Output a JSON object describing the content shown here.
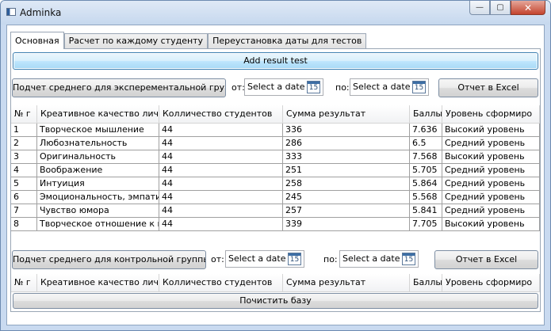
{
  "window": {
    "title": "Adminka",
    "min_glyph": "—",
    "max_glyph": "▢",
    "close_glyph": "✕"
  },
  "tabs": [
    {
      "label": "Основная"
    },
    {
      "label": "Расчет по каждому студенту"
    },
    {
      "label": "Переустановка даты для тестов"
    }
  ],
  "main": {
    "add_button": "Add result test",
    "experimental": {
      "calc_button": "Подчет среднего для эксперементальной группы",
      "from_label": "от:",
      "from_date": "Select a date",
      "to_label": "по:",
      "to_date": "Select a date",
      "export_button": "Отчет в Excel"
    },
    "control": {
      "calc_button": "Подчет среднего для контрольной группы",
      "from_label": "от:",
      "from_date": "Select a date",
      "to_label": "по:",
      "to_date": "Select a date",
      "export_button": "Отчет в Excel"
    },
    "clear_button": "Почистить базу",
    "calendar_day": "15"
  },
  "table": {
    "columns": [
      "№ г",
      "Креативное качество личн",
      "Колличество студентов",
      "Сумма результат",
      "Баллы",
      "Уровень сформиро"
    ],
    "rows": [
      [
        "1",
        "Творческое мышление",
        "44",
        "336",
        "7.636",
        "Высокий уровень"
      ],
      [
        "2",
        "Любознательность",
        "44",
        "286",
        "6.5",
        "Средний уровень"
      ],
      [
        "3",
        "Оригинальность",
        "44",
        "333",
        "7.568",
        "Высокий уровень"
      ],
      [
        "4",
        "Воображение",
        "44",
        "251",
        "5.705",
        "Средний уровень"
      ],
      [
        "5",
        "Интуиция",
        "44",
        "258",
        "5.864",
        "Средний уровень"
      ],
      [
        "6",
        "Эмоциональность, эмпатия",
        "44",
        "245",
        "5.568",
        "Средний уровень"
      ],
      [
        "7",
        "Чувство юмора",
        "44",
        "257",
        "5.841",
        "Средний уровень"
      ],
      [
        "8",
        "Творческое отношение к пр",
        "44",
        "339",
        "7.705",
        "Высокий уровень"
      ]
    ]
  },
  "table2": {
    "columns": [
      "№ г",
      "Креативное качество личнс",
      "Колличество студентов",
      "Сумма результат",
      "Баллы",
      "Уровень сформиро"
    ]
  }
}
